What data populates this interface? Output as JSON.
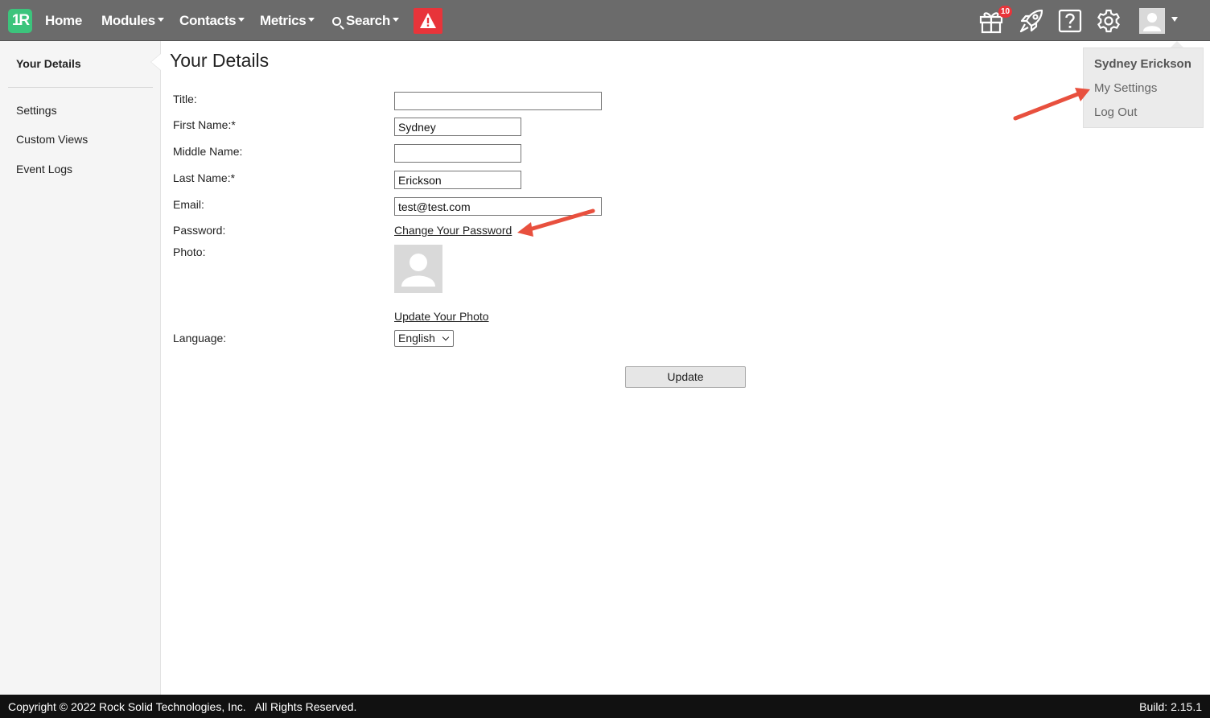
{
  "topnav": {
    "logo": "1R",
    "items": [
      "Home",
      "Modules",
      "Contacts",
      "Metrics",
      "Search"
    ],
    "gift_badge": "10"
  },
  "user_menu": {
    "name": "Sydney Erickson",
    "items": [
      "My Settings",
      "Log Out"
    ]
  },
  "sidebar": {
    "items": [
      "Your Details",
      "Settings",
      "Custom Views",
      "Event Logs"
    ]
  },
  "main": {
    "title": "Your Details",
    "labels": {
      "title": "Title:",
      "first_name": "First Name:*",
      "middle_name": "Middle Name:",
      "last_name": "Last Name:*",
      "email": "Email:",
      "password": "Password:",
      "photo": "Photo:",
      "language": "Language:"
    },
    "values": {
      "title": "",
      "first_name": "Sydney",
      "middle_name": "",
      "last_name": "Erickson",
      "email": "test@test.com",
      "language": "English"
    },
    "change_password_link": "Change Your Password",
    "update_photo_link": "Update Your Photo",
    "update_button": "Update"
  },
  "footer": {
    "copyright": "Copyright © 2022 Rock Solid Technologies, Inc.   All Rights Reserved.",
    "build": "Build: 2.15.1"
  },
  "colors": {
    "topbar": "#6b6b6b",
    "logo": "#3cc47c",
    "alert": "#e8343a",
    "arrow": "#e8503e"
  },
  "icons": [
    "alert-icon",
    "gift-icon",
    "rocket-icon",
    "help-icon",
    "gear-icon",
    "user-avatar-icon"
  ]
}
